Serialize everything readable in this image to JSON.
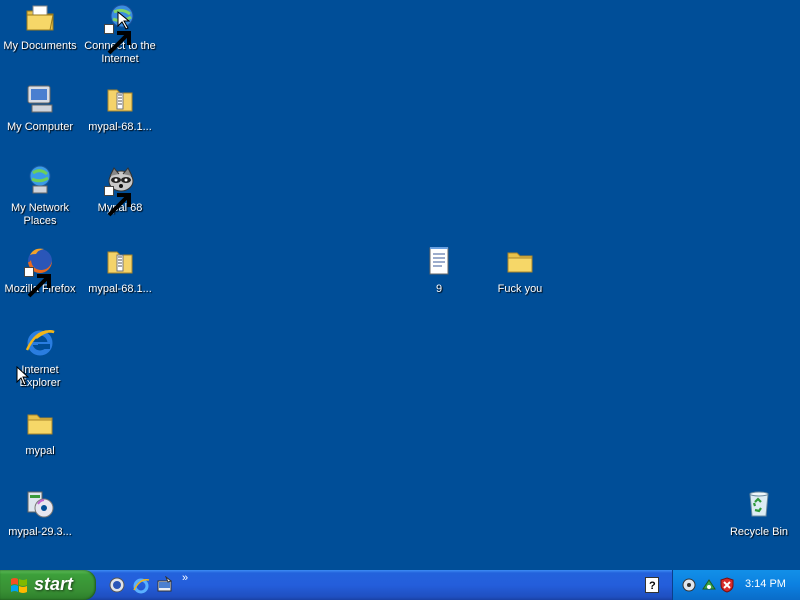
{
  "desktop": {
    "icons": {
      "my_documents": "My Documents",
      "connect_internet": "Connect to the Internet",
      "my_computer": "My Computer",
      "mypal_zip_1": "mypal-68.1...",
      "my_network_places": "My Network Places",
      "mypal_68": "Mypal 68",
      "mozilla_firefox": "Mozilla Firefox",
      "mypal_zip_2": "mypal-68.1...",
      "text_file_9": "9",
      "folder_fuck_you": "Fuck you",
      "internet_explorer": "Internet Explorer",
      "mypal_folder": "mypal",
      "mypal_29_installer": "mypal-29.3...",
      "recycle_bin": "Recycle Bin"
    },
    "background_color": "#004e98"
  },
  "taskbar": {
    "start_label": "start",
    "quick_launch_chevron": "»",
    "clock": "3:14 PM"
  }
}
